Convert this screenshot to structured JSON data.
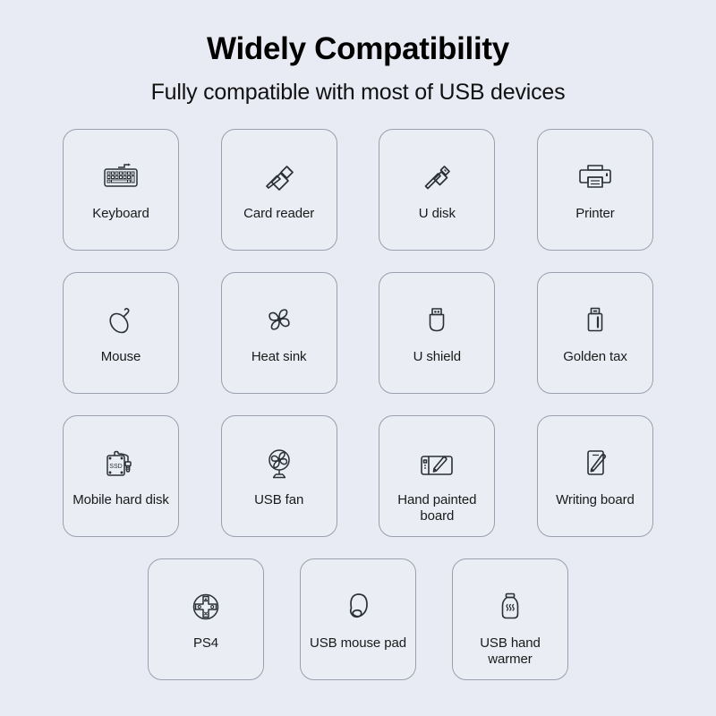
{
  "header": {
    "title": "Widely Compatibility",
    "subtitle": "Fully compatible with most of USB devices"
  },
  "theme": {
    "background": "#e8ebf3",
    "card_fill": "#eaedf4",
    "card_border": "#9aa0ad",
    "icon_stroke": "#2b2f36",
    "text": "#1a1a1a"
  },
  "grid": {
    "rows": [
      {
        "items": [
          {
            "label": "Keyboard",
            "icon": "keyboard-icon"
          },
          {
            "label": "Card reader",
            "icon": "card-reader-icon"
          },
          {
            "label": "U disk",
            "icon": "u-disk-icon"
          },
          {
            "label": "Printer",
            "icon": "printer-icon"
          }
        ]
      },
      {
        "items": [
          {
            "label": "Mouse",
            "icon": "mouse-icon"
          },
          {
            "label": "Heat sink",
            "icon": "heat-sink-icon"
          },
          {
            "label": "U shield",
            "icon": "u-shield-icon"
          },
          {
            "label": "Golden tax",
            "icon": "golden-tax-icon"
          }
        ]
      },
      {
        "items": [
          {
            "label": "Mobile hard disk",
            "icon": "mobile-hard-disk-icon"
          },
          {
            "label": "USB fan",
            "icon": "usb-fan-icon"
          },
          {
            "label": "Hand painted board",
            "icon": "hand-painted-board-icon"
          },
          {
            "label": "Writing board",
            "icon": "writing-board-icon"
          }
        ]
      },
      {
        "items": [
          {
            "label": "PS4",
            "icon": "ps4-controller-icon"
          },
          {
            "label": "USB mouse pad",
            "icon": "usb-mouse-pad-icon"
          },
          {
            "label": "USB hand warmer",
            "icon": "usb-hand-warmer-icon"
          }
        ]
      }
    ]
  },
  "icon_details": {
    "mobile_hard_disk_text": "SSD"
  }
}
